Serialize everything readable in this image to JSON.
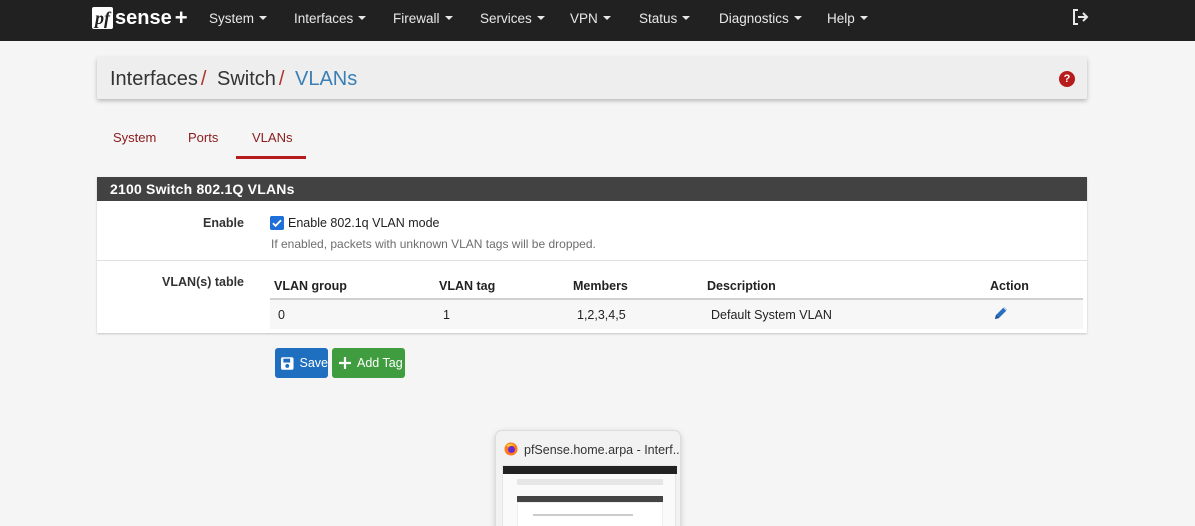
{
  "navbar": {
    "logo": {
      "pf": "pf",
      "sense": "sense",
      "plus": "+"
    },
    "menu": [
      "System",
      "Interfaces",
      "Firewall",
      "Services",
      "VPN",
      "Status",
      "Diagnostics",
      "Help"
    ]
  },
  "breadcrumb": {
    "items": [
      "Interfaces",
      "Switch",
      "VLANs"
    ],
    "separator": "/"
  },
  "help_badge": "?",
  "tabs": [
    "System",
    "Ports",
    "VLANs"
  ],
  "active_tab": "VLANs",
  "panel": {
    "title": "2100 Switch 802.1Q VLANs",
    "enable": {
      "label": "Enable",
      "checkbox_label": "Enable 802.1q VLAN mode",
      "checked": true,
      "hint": "If enabled, packets with unknown VLAN tags will be dropped."
    },
    "vlan_table": {
      "label": "VLAN(s) table",
      "headers": [
        "VLAN group",
        "VLAN tag",
        "Members",
        "Description",
        "Action"
      ],
      "rows": [
        {
          "group": "0",
          "tag": "1",
          "members": "1,2,3,4,5",
          "description": "Default System VLAN",
          "action_icon": "pencil-icon"
        }
      ]
    }
  },
  "buttons": {
    "save": "Save",
    "add_tag": "Add Tag"
  },
  "taskbar_preview": {
    "title": "pfSense.home.arpa - Interf..."
  },
  "colors": {
    "navbar": "#212121",
    "accent_red": "#b71c1c",
    "link_blue": "#3a7fb5",
    "save_blue": "#1e6fbf",
    "add_green": "#3f9d3f"
  }
}
